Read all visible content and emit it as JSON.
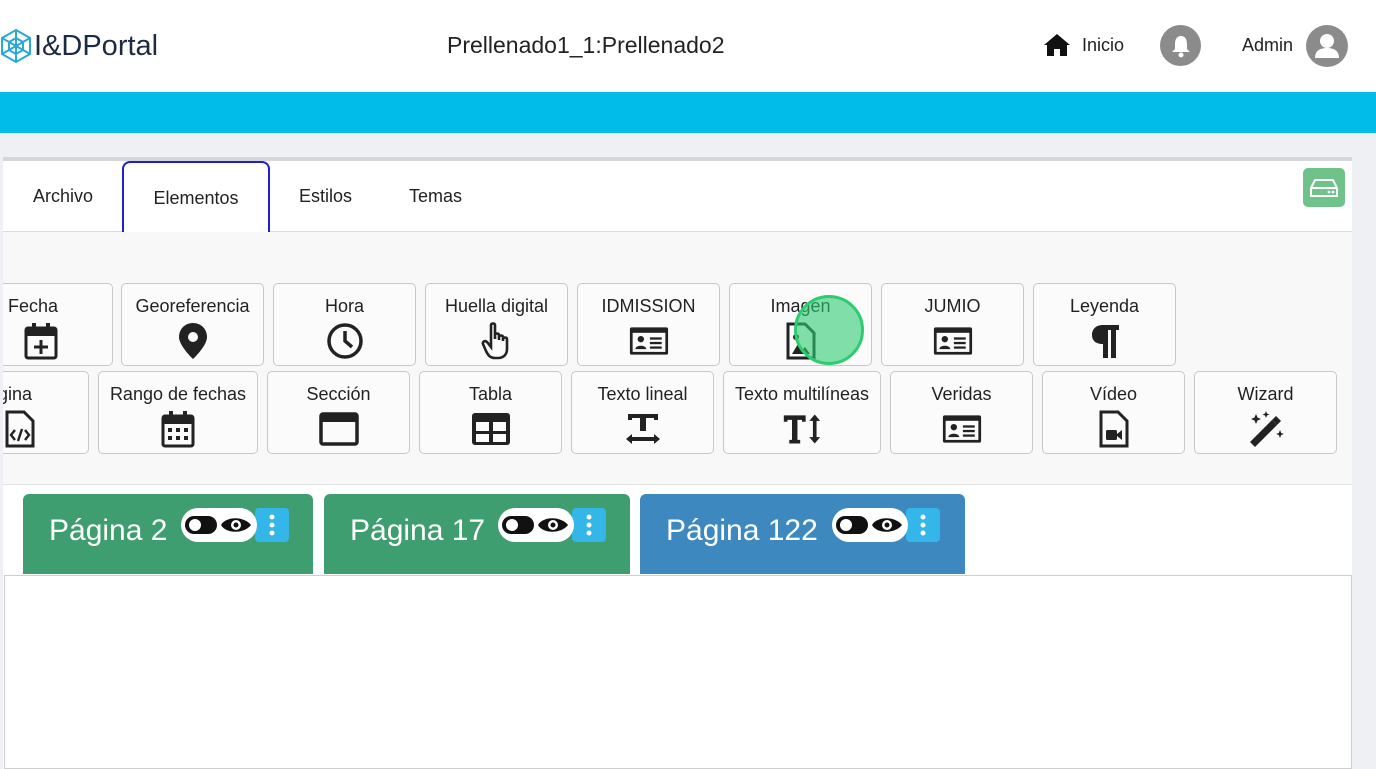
{
  "app": {
    "logo_text": "I&DPortal",
    "document_title": "Prellenado1_1:Prellenado2"
  },
  "header": {
    "home_label": "Inicio",
    "user_label": "Admin",
    "icons": [
      "home-icon",
      "bell-icon",
      "user-avatar-icon"
    ]
  },
  "tabs": [
    {
      "label": "Archivo",
      "active": false
    },
    {
      "label": "Elementos",
      "active": true
    },
    {
      "label": "Estilos",
      "active": false
    },
    {
      "label": "Temas",
      "active": false
    }
  ],
  "toolbox": {
    "row1": [
      {
        "label": "Fecha",
        "icon": "calendar-plus-icon"
      },
      {
        "label": "Georeferencia",
        "icon": "map-pin-icon"
      },
      {
        "label": "Hora",
        "icon": "clock-icon"
      },
      {
        "label": "Huella digital",
        "icon": "hand-pointer-icon"
      },
      {
        "label": "IDMISSION",
        "icon": "id-card-icon"
      },
      {
        "label": "Imagen",
        "icon": "file-image-icon"
      },
      {
        "label": "JUMIO",
        "icon": "id-card-icon"
      },
      {
        "label": "Leyenda",
        "icon": "paragraph-icon"
      }
    ],
    "row2": [
      {
        "label": "gina",
        "icon": "file-code-icon"
      },
      {
        "label": "Rango de fechas",
        "icon": "calendar-icon"
      },
      {
        "label": "Sección",
        "icon": "window-icon"
      },
      {
        "label": "Tabla",
        "icon": "table-icon"
      },
      {
        "label": "Texto lineal",
        "icon": "text-width-icon"
      },
      {
        "label": "Texto multilíneas",
        "icon": "text-height-icon"
      },
      {
        "label": "Veridas",
        "icon": "id-card-icon"
      },
      {
        "label": "Vídeo",
        "icon": "file-video-icon"
      },
      {
        "label": "Wizard",
        "icon": "magic-wand-icon"
      }
    ]
  },
  "pages": [
    {
      "label": "Página 2",
      "color": "#3f9e6f"
    },
    {
      "label": "Página 17",
      "color": "#3f9e6f"
    },
    {
      "label": "Página 122",
      "color": "#3d89bf"
    }
  ],
  "colors": {
    "accent_bar": "#01bbe8",
    "active_tab_border": "#1f1fd0",
    "drive_button": "#6fc28a",
    "kebab": "#35b6e8"
  }
}
